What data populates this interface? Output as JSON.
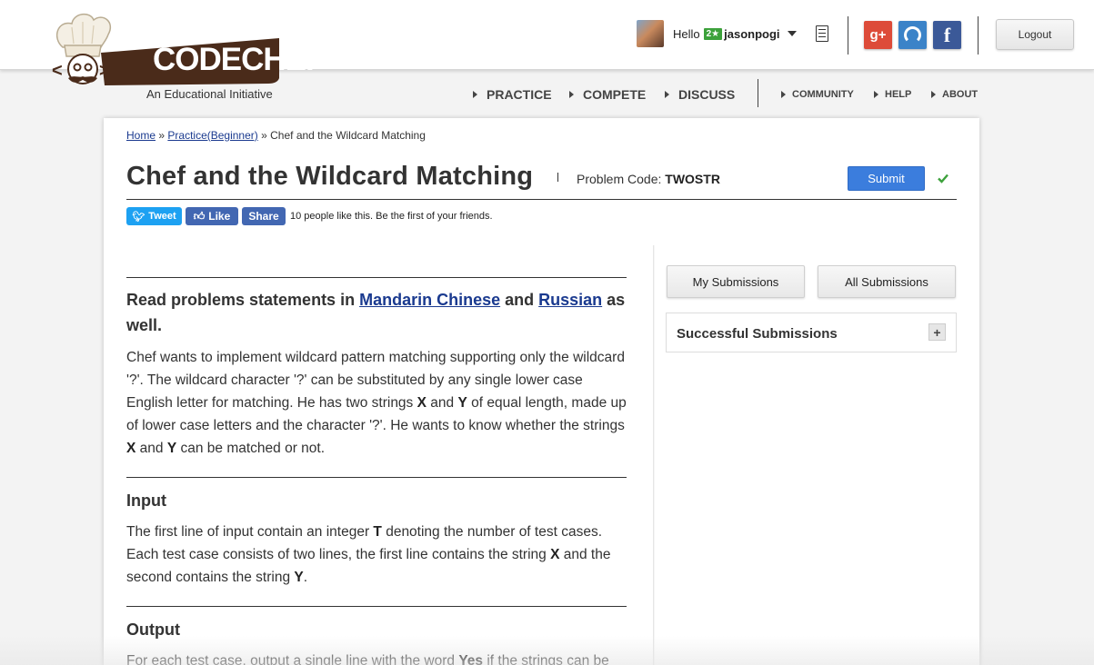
{
  "brand": {
    "logo_text": "CODECHEF",
    "tagline": "An Educational Initiative"
  },
  "user": {
    "greeting": "Hello",
    "rating_badge": "2★",
    "username": "jasonpogi"
  },
  "header": {
    "logout_label": "Logout",
    "social": [
      {
        "name": "google-plus-icon",
        "glyph": "g+",
        "color": "#dd4b39"
      },
      {
        "name": "github-icon",
        "glyph": "",
        "color": "#3b83c8"
      },
      {
        "name": "facebook-icon",
        "glyph": "f",
        "color": "#3b5998"
      }
    ]
  },
  "nav": {
    "primary": [
      "PRACTICE",
      "COMPETE",
      "DISCUSS"
    ],
    "secondary": [
      "COMMUNITY",
      "HELP",
      "ABOUT"
    ]
  },
  "breadcrumb": {
    "home": "Home",
    "sep1": "»",
    "practice": "Practice(Beginner)",
    "sep2": "»",
    "current": "Chef and the Wildcard Matching"
  },
  "problem": {
    "title": "Chef and the Wildcard Matching",
    "code_label": "Problem Code:",
    "code": "TWOSTR",
    "submit_label": "Submit"
  },
  "share": {
    "tweet_label": "Tweet",
    "like_label": "Like",
    "share_label": "Share",
    "likes_text": "10 people like this. Be the first of your friends."
  },
  "statement": {
    "lang_pre": "Read problems statements in ",
    "lang_1": "Mandarin Chinese",
    "lang_mid": " and ",
    "lang_2": "Russian",
    "lang_post": " as well.",
    "body_parts": [
      "Chef wants to implement wildcard pattern matching supporting only the wildcard '?'. The wildcard character '?' can be substituted by any single lower case English letter for matching. He has two strings ",
      "X",
      " and ",
      "Y",
      " of equal length, made up of lower case letters and the character '?'. He wants to know whether the strings ",
      "X",
      " and ",
      "Y",
      " can be matched or not."
    ],
    "input_heading": "Input",
    "input_parts": [
      "The first line of input contain an integer ",
      "T",
      " denoting the number of test cases. Each test case consists of two lines, the first line contains the string ",
      "X",
      " and the second contains the string ",
      "Y",
      "."
    ],
    "output_heading": "Output",
    "output_parts": [
      "For each test case, output a single line with the word ",
      "Yes",
      " if the strings can be"
    ]
  },
  "side": {
    "my_submissions": "My Submissions",
    "all_submissions": "All Submissions",
    "successful_title": "Successful Submissions",
    "expand_glyph": "+"
  },
  "colors": {
    "brand_brown": "#4a2b1a",
    "link_blue": "#1a3a8f",
    "submit_blue": "#3b7ddd",
    "check_green": "#3ca13b"
  }
}
